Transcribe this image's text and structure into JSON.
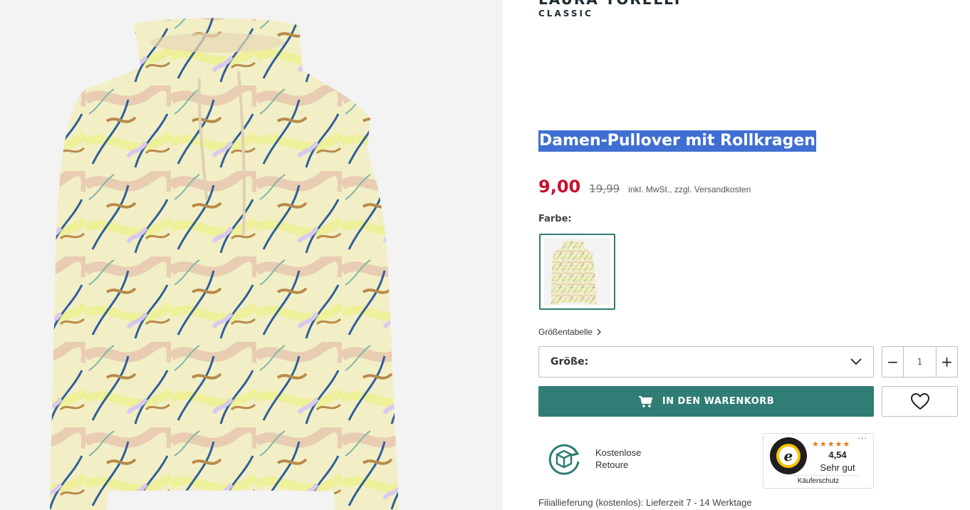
{
  "brand": {
    "name": "LAURA TORELLI",
    "sub": "CLASSIC"
  },
  "product": {
    "title": "Damen-Pullover mit Rollkragen"
  },
  "price": {
    "current": "9,00",
    "old": "19,99",
    "note": "inkl. MwSt., zzgl. Versandkosten",
    "current_color": "#c8102e"
  },
  "color_section": {
    "label": "Farbe:"
  },
  "size_table_link": {
    "label": "Größentabelle"
  },
  "size_select": {
    "label": "Größe:"
  },
  "quantity": {
    "value": "1",
    "minus": "−",
    "plus": "+"
  },
  "cart_button": {
    "label": "IN DEN WARENKORB",
    "color": "#2f7d74"
  },
  "returns": {
    "line1": "Kostenlose",
    "line2": "Retoure"
  },
  "trusted_shops": {
    "stars": "★★★★★",
    "score": "4,54",
    "rating": "Sehr gut",
    "protection": "Käuferschutz",
    "menu": "···"
  },
  "delivery": {
    "text": "Filiallieferung (kostenlos): Lieferzeit 7 - 14 Werktage"
  },
  "icons": [
    "cart-icon",
    "heart-icon",
    "chevron-down-icon",
    "chevron-right-icon",
    "return-box-icon",
    "trusted-shops-seal-icon"
  ]
}
